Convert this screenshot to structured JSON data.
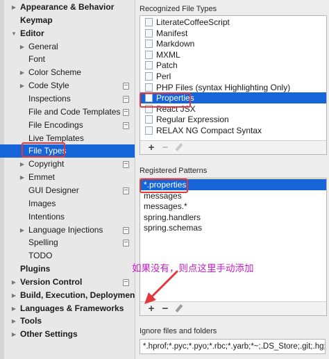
{
  "sidebar": {
    "items": [
      {
        "label": "Appearance & Behavior",
        "level": 0,
        "arrow": "collapsed",
        "bold": true
      },
      {
        "label": "Keymap",
        "level": 0,
        "arrow": "none",
        "bold": true
      },
      {
        "label": "Editor",
        "level": 0,
        "arrow": "expanded",
        "bold": true
      },
      {
        "label": "General",
        "level": 1,
        "arrow": "collapsed"
      },
      {
        "label": "Font",
        "level": 1,
        "arrow": "none"
      },
      {
        "label": "Color Scheme",
        "level": 1,
        "arrow": "collapsed"
      },
      {
        "label": "Code Style",
        "level": 1,
        "arrow": "collapsed",
        "project": true
      },
      {
        "label": "Inspections",
        "level": 1,
        "arrow": "none",
        "project": true
      },
      {
        "label": "File and Code Templates",
        "level": 1,
        "arrow": "none",
        "project": true
      },
      {
        "label": "File Encodings",
        "level": 1,
        "arrow": "none",
        "project": true
      },
      {
        "label": "Live Templates",
        "level": 1,
        "arrow": "none"
      },
      {
        "label": "File Types",
        "level": 1,
        "arrow": "none",
        "selected": true
      },
      {
        "label": "Copyright",
        "level": 1,
        "arrow": "collapsed",
        "project": true
      },
      {
        "label": "Emmet",
        "level": 1,
        "arrow": "collapsed"
      },
      {
        "label": "GUI Designer",
        "level": 1,
        "arrow": "none",
        "project": true
      },
      {
        "label": "Images",
        "level": 1,
        "arrow": "none"
      },
      {
        "label": "Intentions",
        "level": 1,
        "arrow": "none"
      },
      {
        "label": "Language Injections",
        "level": 1,
        "arrow": "collapsed",
        "project": true
      },
      {
        "label": "Spelling",
        "level": 1,
        "arrow": "none",
        "project": true
      },
      {
        "label": "TODO",
        "level": 1,
        "arrow": "none"
      },
      {
        "label": "Plugins",
        "level": 0,
        "arrow": "none",
        "bold": true
      },
      {
        "label": "Version Control",
        "level": 0,
        "arrow": "collapsed",
        "bold": true,
        "project": true
      },
      {
        "label": "Build, Execution, Deployment",
        "level": 0,
        "arrow": "collapsed",
        "bold": true
      },
      {
        "label": "Languages & Frameworks",
        "level": 0,
        "arrow": "collapsed",
        "bold": true
      },
      {
        "label": "Tools",
        "level": 0,
        "arrow": "collapsed",
        "bold": true
      },
      {
        "label": "Other Settings",
        "level": 0,
        "arrow": "collapsed",
        "bold": true
      }
    ]
  },
  "file_types": {
    "title": "Recognized File Types",
    "items": [
      {
        "name": "LiterateCoffeeScript",
        "icon": "coffeescript-file-icon"
      },
      {
        "name": "Manifest",
        "icon": "manifest-file-icon"
      },
      {
        "name": "Markdown",
        "icon": "markdown-file-icon"
      },
      {
        "name": "MXML",
        "icon": "mxml-file-icon"
      },
      {
        "name": "Patch",
        "icon": "patch-file-icon"
      },
      {
        "name": "Perl",
        "icon": "perl-file-icon"
      },
      {
        "name": "PHP Files (syntax Highlighting Only)",
        "icon": "php-file-icon"
      },
      {
        "name": "Properties",
        "icon": "properties-file-icon",
        "selected": true
      },
      {
        "name": "React JSX",
        "icon": "jsx-file-icon"
      },
      {
        "name": "Regular Expression",
        "icon": "regexp-file-icon"
      },
      {
        "name": "RELAX NG Compact Syntax",
        "icon": "rnc-file-icon"
      }
    ]
  },
  "patterns": {
    "title": "Registered Patterns",
    "items": [
      {
        "name": "*.properties",
        "selected": true
      },
      {
        "name": "messages"
      },
      {
        "name": "messages.*"
      },
      {
        "name": "spring.handlers"
      },
      {
        "name": "spring.schemas"
      }
    ]
  },
  "toolbar": {
    "add": "+",
    "remove": "−"
  },
  "annotation": "如果没有，则点这里手动添加",
  "ignore": {
    "title": "Ignore files and folders",
    "value": "*.hprof;*.pyc;*.pyo;*.rbc;*.yarb;*~;.DS_Store;.git;.hg;.svn;"
  },
  "colors": {
    "selection": "#1665d8",
    "highlight": "#e2383c",
    "annotation": "#c21fc4"
  }
}
